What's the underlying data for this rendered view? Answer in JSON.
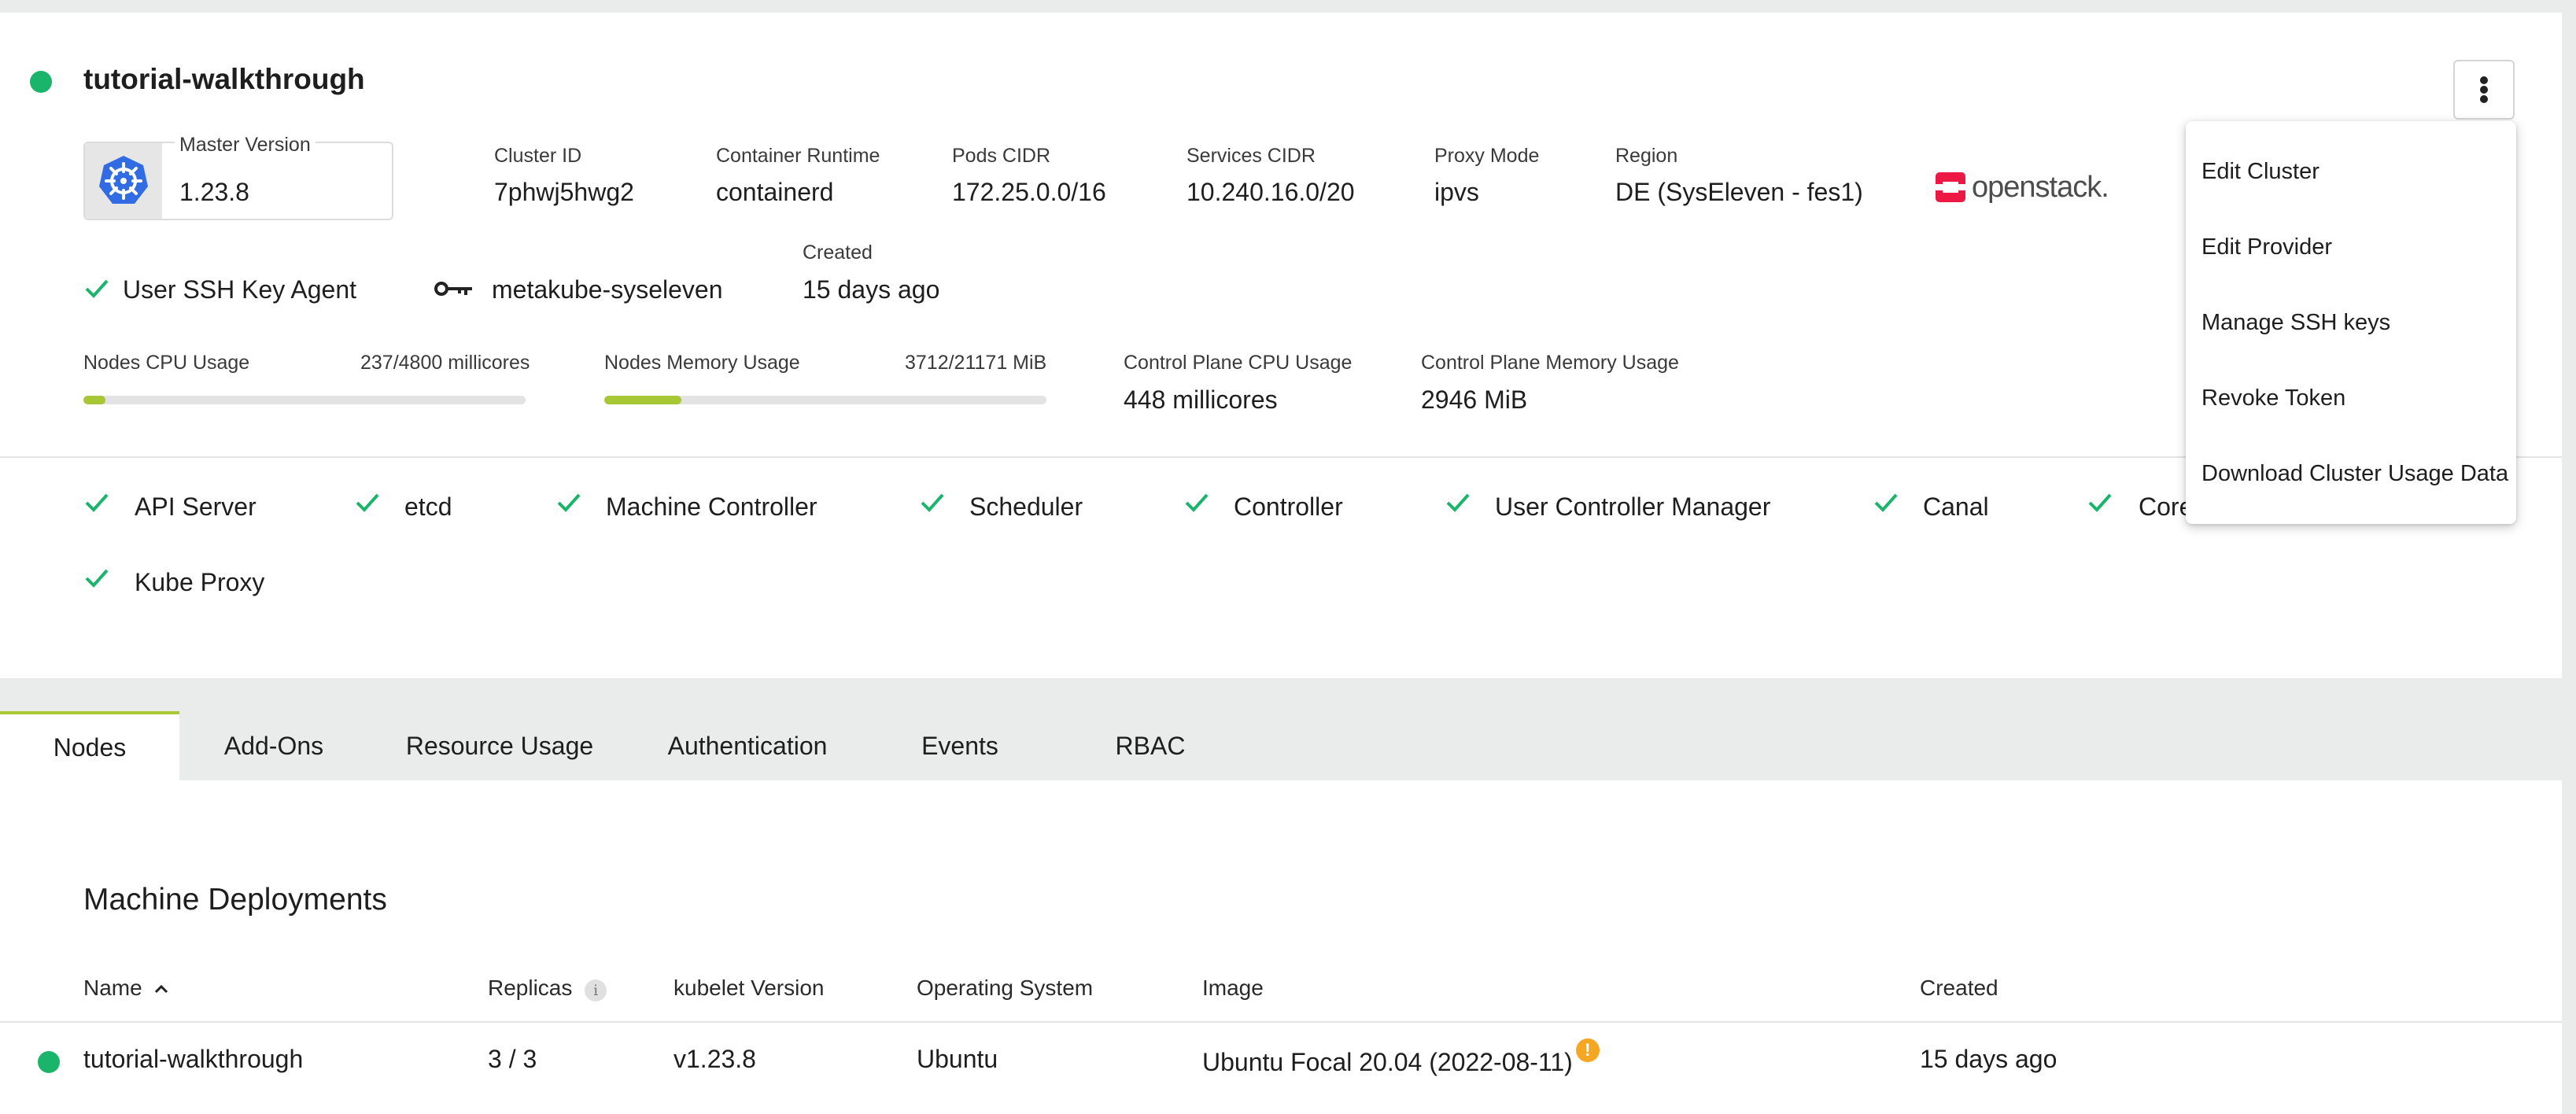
{
  "cluster": {
    "name": "tutorial-walkthrough",
    "master_version_label": "Master Version",
    "master_version": "1.23.8",
    "fields": [
      {
        "label": "Cluster ID",
        "value": "7phwj5hwg2"
      },
      {
        "label": "Container Runtime",
        "value": "containerd"
      },
      {
        "label": "Pods CIDR",
        "value": "172.25.0.0/16"
      },
      {
        "label": "Services CIDR",
        "value": "10.240.16.0/20"
      },
      {
        "label": "Proxy Mode",
        "value": "ipvs"
      },
      {
        "label": "Region",
        "value": "DE (SysEleven - fes1)"
      }
    ],
    "provider_logo_text": "openstack.",
    "ssh_agent_label": "User SSH Key Agent",
    "ssh_key_name": "metakube-syseleven",
    "created_label": "Created",
    "created_value": "15 days ago"
  },
  "usage": {
    "cpu": {
      "label": "Nodes CPU Usage",
      "value": "237/4800 millicores",
      "fraction": 0.049
    },
    "memory": {
      "label": "Nodes Memory Usage",
      "value": "3712/21171 MiB",
      "fraction": 0.175
    },
    "cp_cpu": {
      "label": "Control Plane CPU Usage",
      "value": "448 millicores"
    },
    "cp_memory": {
      "label": "Control Plane Memory Usage",
      "value": "2946 MiB"
    }
  },
  "health": [
    "API Server",
    "etcd",
    "Machine Controller",
    "Scheduler",
    "Controller",
    "User Controller Manager",
    "Canal",
    "Core",
    "Kube Proxy"
  ],
  "menu": {
    "items": [
      "Edit Cluster",
      "Edit Provider",
      "Manage SSH keys",
      "Revoke Token",
      "Download Cluster Usage Data"
    ]
  },
  "tabs": [
    "Nodes",
    "Add-Ons",
    "Resource Usage",
    "Authentication",
    "Events",
    "RBAC"
  ],
  "machine_deployments": {
    "title": "Machine Deployments",
    "columns": [
      "Name",
      "Replicas",
      "kubelet Version",
      "Operating System",
      "Image",
      "Created"
    ],
    "rows": [
      {
        "name": "tutorial-walkthrough",
        "replicas": "3 / 3",
        "kubelet": "v1.23.8",
        "os": "Ubuntu",
        "image": "Ubuntu Focal 20.04 (2022-08-11)",
        "created": "15 days ago"
      }
    ]
  },
  "colors": {
    "accent": "#a7c834",
    "healthy": "#1ab56a",
    "warning": "#f5a623",
    "openstack": "#ed1944"
  }
}
